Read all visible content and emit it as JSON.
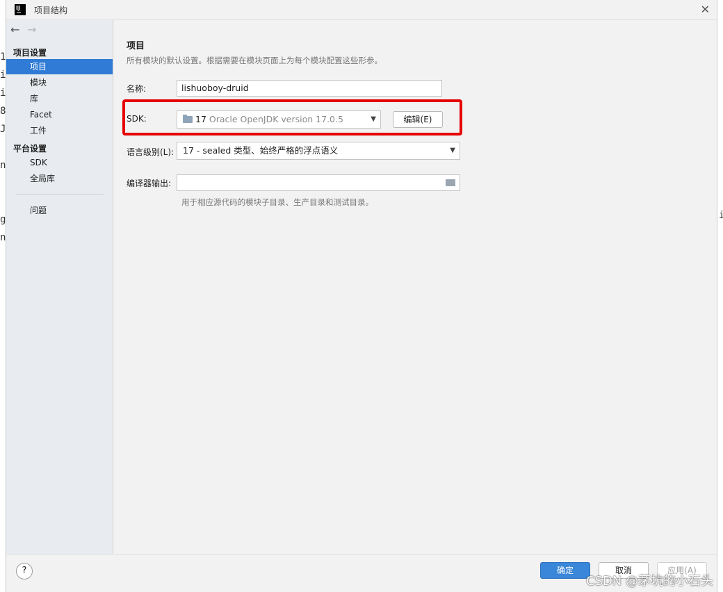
{
  "window": {
    "title": "项目结构"
  },
  "sidebar": {
    "section_project": "项目设置",
    "project_items": [
      "项目",
      "模块",
      "库",
      "Facet",
      "工件"
    ],
    "section_platform": "平台设置",
    "platform_items": [
      "SDK",
      "全局库"
    ],
    "problems": "问题",
    "selected": "项目"
  },
  "main": {
    "title": "项目",
    "description": "所有模块的默认设置。根据需要在模块页面上为每个模块配置这些形参。",
    "name_label": "名称:",
    "name_value": "lishuoboy-druid",
    "sdk_label": "SDK:",
    "sdk_version": "17",
    "sdk_detail": "Oracle OpenJDK version 17.0.5",
    "edit_button": "编辑(E)",
    "language_label": "语言级别(L):",
    "language_value": "17 - sealed 类型、始终严格的浮点语义",
    "compiler_label": "编译器输出:",
    "compiler_value": "",
    "compiler_hint": "用于相应源代码的模块子目录、生产目录和测试目录。"
  },
  "footer": {
    "help": "?",
    "ok": "确定",
    "cancel": "取消",
    "apply": "应用(A)"
  },
  "watermark": "CSDN @茅坑的小石头",
  "colors": {
    "selection": "#2f7bd5",
    "highlight_box": "#e60000",
    "ok_button": "#3a86d8"
  }
}
